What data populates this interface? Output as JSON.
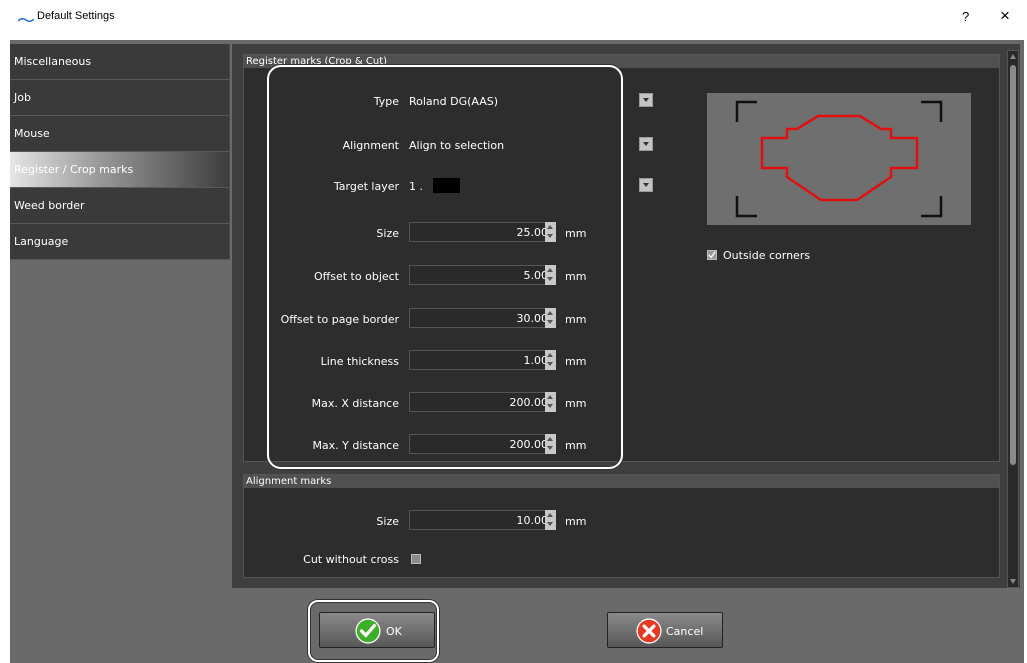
{
  "window": {
    "title": "Default Settings",
    "help_label": "?",
    "close_label": "×"
  },
  "sidebar": {
    "items": [
      {
        "label": "Miscellaneous"
      },
      {
        "label": "Job"
      },
      {
        "label": "Mouse"
      },
      {
        "label": "Register / Crop marks",
        "active": true
      },
      {
        "label": "Weed border"
      },
      {
        "label": "Language"
      }
    ]
  },
  "register_section": {
    "header": "Register marks (Crop & Cut)",
    "type_label": "Type",
    "type_value": "Roland DG(AAS)",
    "alignment_label": "Alignment",
    "alignment_value": "Align to selection",
    "target_layer_label": "Target layer",
    "target_layer_value": "1 .",
    "target_layer_color": "#000000",
    "size_label": "Size",
    "size_value": "25.00",
    "offset_object_label": "Offset to object",
    "offset_object_value": "5.00",
    "offset_page_label": "Offset to page border",
    "offset_page_value": "30.00",
    "line_thickness_label": "Line thickness",
    "line_thickness_value": "1.00",
    "max_x_label": "Max. X distance",
    "max_x_value": "200.00",
    "max_y_label": "Max. Y distance",
    "max_y_value": "200.00",
    "unit": "mm",
    "outside_corners_label": "Outside corners",
    "outside_corners_checked": true,
    "preview_mark_color": "#e01010"
  },
  "alignment_section": {
    "header": "Alignment marks",
    "size_label": "Size",
    "size_value": "10.00",
    "unit": "mm",
    "cut_without_cross_label": "Cut without cross",
    "cut_without_cross_checked": false
  },
  "buttons": {
    "ok_label": "OK",
    "cancel_label": "Cancel"
  }
}
